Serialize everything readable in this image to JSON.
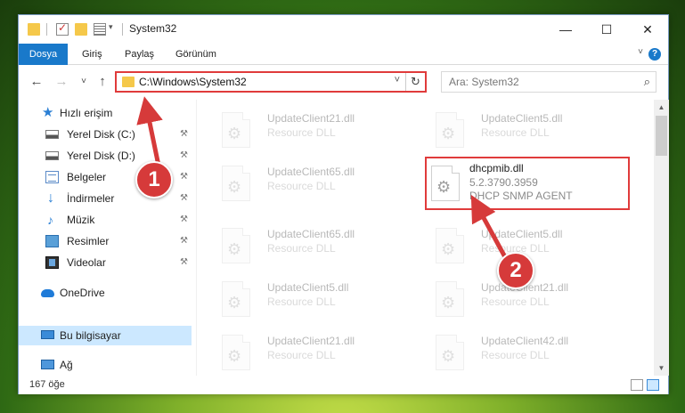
{
  "window": {
    "title": "System32",
    "controls": {
      "minimize": "—",
      "maximize": "☐",
      "close": "✕"
    }
  },
  "quick_access": {
    "dropdown_glyph": "▾",
    "icons": [
      "folder-icon",
      "properties-icon",
      "new-folder-icon",
      "customize-icon"
    ]
  },
  "ribbon": {
    "tabs": [
      "Dosya",
      "Giriş",
      "Paylaş",
      "Görünüm"
    ],
    "collapse_glyph": "˅",
    "help_glyph": "?"
  },
  "nav": {
    "back_glyph": "←",
    "forward_glyph": "→",
    "recent_glyph": "˅",
    "up_glyph": "↑"
  },
  "address": {
    "path": "C:\\Windows\\System32",
    "dropdown_glyph": "˅",
    "refresh_glyph": "↻"
  },
  "search": {
    "placeholder": "Ara: System32",
    "icon_glyph": "⌕"
  },
  "sidebar": {
    "pin_glyph": "⚒",
    "items": [
      {
        "label": "Hızlı erişim",
        "icon": "star-icon",
        "glyph": "★",
        "pinned": false
      },
      {
        "label": "Yerel Disk (C:)",
        "icon": "drive-icon",
        "glyph": "",
        "pinned": true
      },
      {
        "label": "Yerel Disk (D:)",
        "icon": "drive-icon",
        "glyph": "",
        "pinned": true
      },
      {
        "label": "Belgeler",
        "icon": "documents-icon",
        "glyph": "",
        "pinned": true
      },
      {
        "label": "İndirmeler",
        "icon": "downloads-icon",
        "glyph": "↓",
        "pinned": true
      },
      {
        "label": "Müzik",
        "icon": "music-icon",
        "glyph": "♪",
        "pinned": true
      },
      {
        "label": "Resimler",
        "icon": "pictures-icon",
        "glyph": "",
        "pinned": true
      },
      {
        "label": "Videolar",
        "icon": "videos-icon",
        "glyph": "",
        "pinned": true
      },
      {
        "label": "OneDrive",
        "icon": "onedrive-icon",
        "glyph": "",
        "pinned": false
      },
      {
        "label": "Bu bilgisayar",
        "icon": "this-pc-icon",
        "glyph": "",
        "pinned": false,
        "selected": true
      },
      {
        "label": "Ağ",
        "icon": "network-icon",
        "glyph": "",
        "pinned": false
      }
    ]
  },
  "files": [
    {
      "name": "UpdateClient21.dll",
      "line2": "Resource DLL",
      "line3": "",
      "faded": true
    },
    {
      "name": "UpdateClient5.dll",
      "line2": "Resource DLL",
      "line3": "",
      "faded": true
    },
    {
      "name": "UpdateClient65.dll",
      "line2": "Resource DLL",
      "line3": "",
      "faded": true
    },
    {
      "name": "dhcpmib.dll",
      "line2": "5.2.3790.3959",
      "line3": "DHCP SNMP AGENT",
      "faded": false,
      "highlighted": true
    },
    {
      "name": "UpdateClient65.dll",
      "line2": "Resource DLL",
      "line3": "",
      "faded": true
    },
    {
      "name": "UpdateClient5.dll",
      "line2": "Resource DLL",
      "line3": "",
      "faded": true
    },
    {
      "name": "UpdateClient5.dll",
      "line2": "Resource DLL",
      "line3": "",
      "faded": true
    },
    {
      "name": "UpdateClient21.dll",
      "line2": "Resource DLL",
      "line3": "",
      "faded": true
    },
    {
      "name": "UpdateClient21.dll",
      "line2": "Resource DLL",
      "line3": "",
      "faded": true
    },
    {
      "name": "UpdateClient42.dll",
      "line2": "Resource DLL",
      "line3": "",
      "faded": true
    }
  ],
  "status": {
    "item_count": "167 öğe"
  },
  "scrollbar": {
    "up_glyph": "▲",
    "down_glyph": "▼"
  },
  "annotations": [
    {
      "number": "1",
      "color": "#d63a3a"
    },
    {
      "number": "2",
      "color": "#d63a3a"
    }
  ]
}
